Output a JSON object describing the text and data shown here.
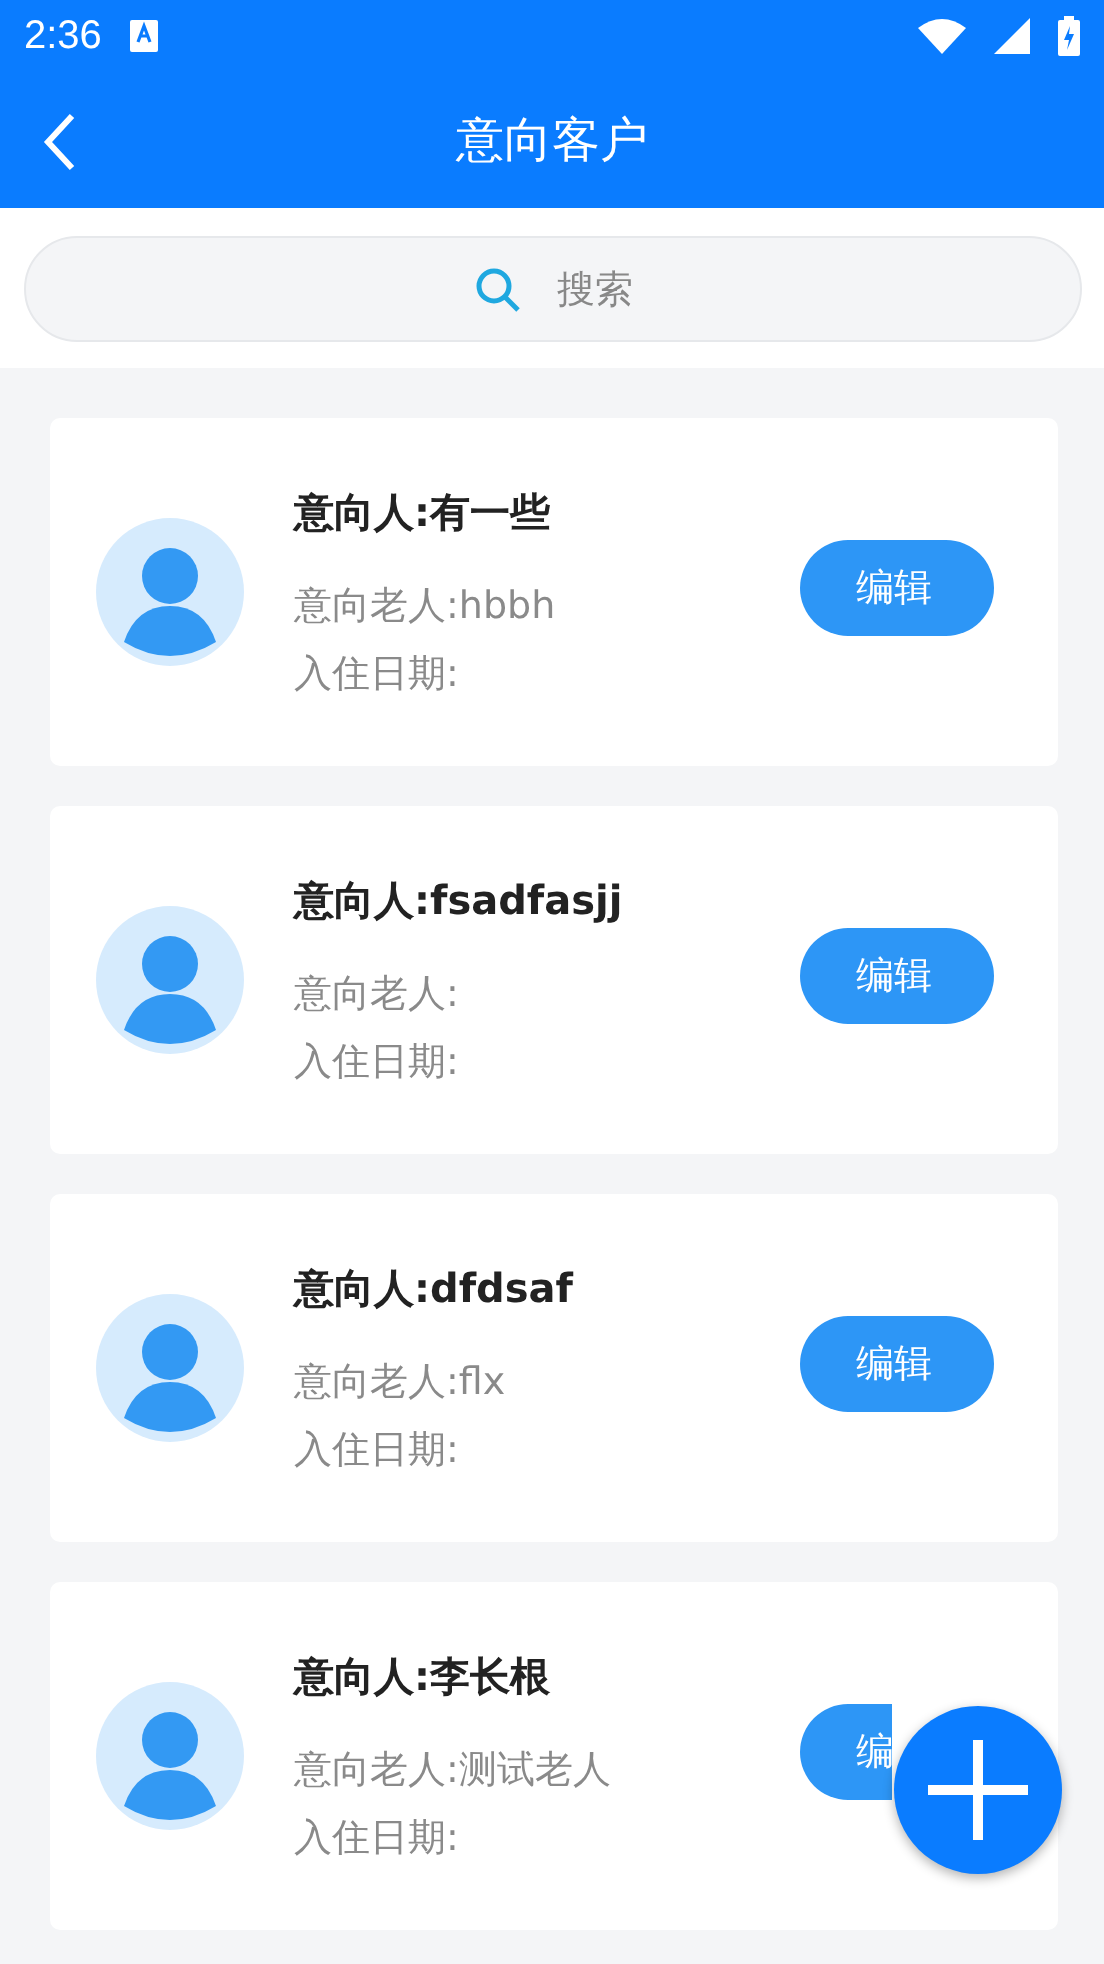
{
  "status_bar": {
    "time": "2:36"
  },
  "header": {
    "title": "意向客户"
  },
  "search": {
    "placeholder": "搜索"
  },
  "customers": [
    {
      "name": "意向人:有一些",
      "elder": "意向老人:hbbh",
      "date": "入住日期:",
      "button": "编辑"
    },
    {
      "name": "意向人:fsadfasjj",
      "elder": "意向老人:",
      "date": "入住日期:",
      "button": "编辑"
    },
    {
      "name": "意向人:dfdsaf",
      "elder": "意向老人:flx",
      "date": "入住日期:",
      "button": "编辑"
    },
    {
      "name": "意向人:李长根",
      "elder": "意向老人:测试老人",
      "date": "入住日期:",
      "button": "编"
    }
  ]
}
